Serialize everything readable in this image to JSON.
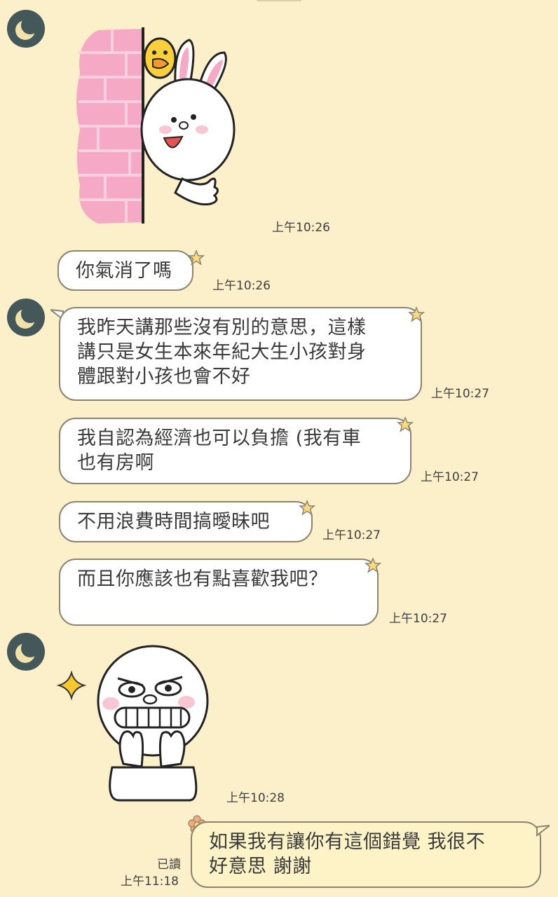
{
  "messages": [
    {
      "id": "sticker-peek",
      "type": "sticker",
      "time": "上午10:26"
    },
    {
      "id": "m1",
      "type": "text",
      "text": "你氣消了嗎",
      "time": "上午10:26"
    },
    {
      "id": "m2",
      "type": "text",
      "text": "我昨天講那些沒有別的意思，這樣\n講只是女生本來年紀大生小孩對身\n體跟對小孩也會不好",
      "time": "上午10:27"
    },
    {
      "id": "m3",
      "type": "text",
      "text": "我自認為經濟也可以負擔 (我有車\n也有房啊",
      "time": "上午10:27"
    },
    {
      "id": "m4",
      "type": "text",
      "text": "不用浪費時間搞曖昧吧",
      "time": "上午10:27"
    },
    {
      "id": "m5",
      "type": "text",
      "text": "而且你應該也有點喜歡我吧？",
      "time": "上午10:27"
    },
    {
      "id": "sticker-grin",
      "type": "sticker",
      "time": "上午10:28"
    },
    {
      "id": "m6",
      "type": "text",
      "text": "如果我有讓你有這個錯覺 我很不\n好意思 謝謝",
      "time": "上午11:18",
      "read": "已讀"
    }
  ],
  "colors": {
    "background": "#fbf0c9",
    "avatar": "#44585a",
    "moon": "#f1e2a9",
    "bubble_border": "#8c8370"
  },
  "icons": {
    "avatar": "crescent-moon-icon",
    "bubble_decoration": "star-icon",
    "mine_decoration": "flower-icon"
  }
}
